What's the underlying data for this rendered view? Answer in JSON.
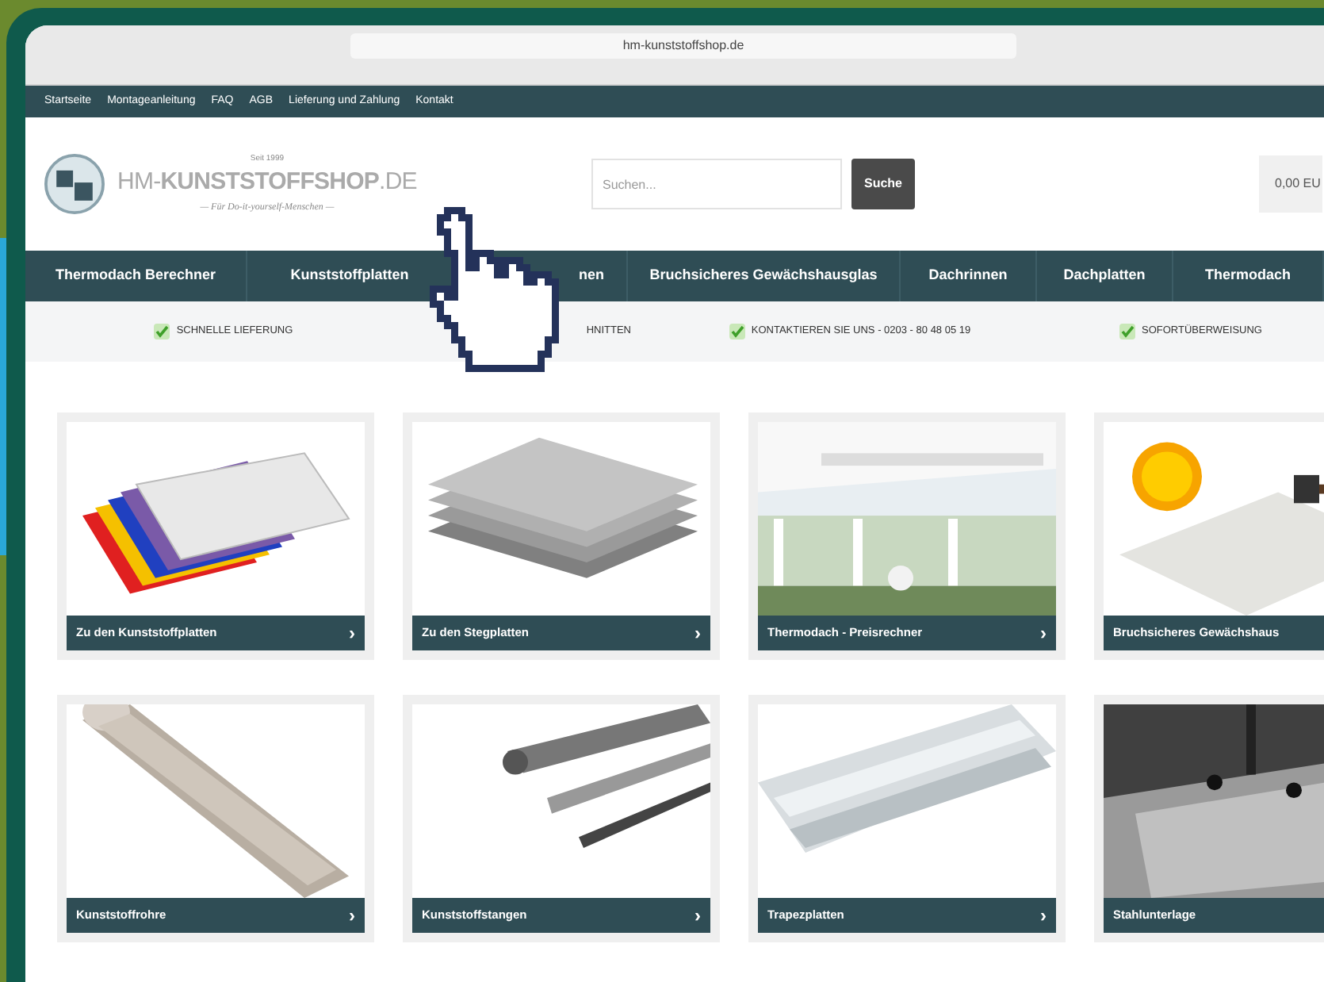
{
  "browser": {
    "address": "hm-kunststoffshop.de"
  },
  "top_nav": [
    "Startseite",
    "Montageanleitung",
    "FAQ",
    "AGB",
    "Lieferung und Zahlung",
    "Kontakt"
  ],
  "logo": {
    "since": "Seit 1999",
    "name": "HM-**KUNSTSTOFFSHOP**.DE",
    "tagline": "— Für Do-it-yourself-Menschen —"
  },
  "search": {
    "placeholder": "Suchen...",
    "button": "Suche"
  },
  "cart": {
    "total": "0,00 EU"
  },
  "main_nav": [
    "Thermodach Berechner",
    "Kunststoffplatten",
    "nen",
    "Bruchsicheres Gewächshausglas",
    "Dachrinnen",
    "Dachplatten",
    "Thermodach"
  ],
  "trust_bar": [
    {
      "label": "SCHNELLE LIEFERUNG",
      "check_icon": true
    },
    {
      "label": "HNITTEN",
      "check_icon": false
    },
    {
      "label": "KONTAKTIEREN SIE UNS - 0203 - 80 48 05 19",
      "check_icon": true
    },
    {
      "label": "SOFORTÜBERWEISUNG",
      "check_icon": true
    }
  ],
  "cards": [
    {
      "label": "Zu den Kunststoffplatten",
      "arrow": "›",
      "kind": "picture"
    },
    {
      "label": "Zu den Stegplatten",
      "arrow": "›",
      "kind": "picture"
    },
    {
      "label": "Thermodach - Preisrechner",
      "arrow": "›",
      "kind": "picture"
    },
    {
      "label": "Bruchsicheres Gewächshaus",
      "kind": "picture"
    },
    {
      "label": "Kunststoffrohre",
      "arrow": "›",
      "kind": "picture"
    },
    {
      "label": "Kunststoffstangen",
      "arrow": "›",
      "kind": "picture"
    },
    {
      "label": "Trapezplatten",
      "arrow": "›",
      "kind": "picture"
    },
    {
      "label": "Stahlunterlage",
      "kind": "picture"
    }
  ]
}
